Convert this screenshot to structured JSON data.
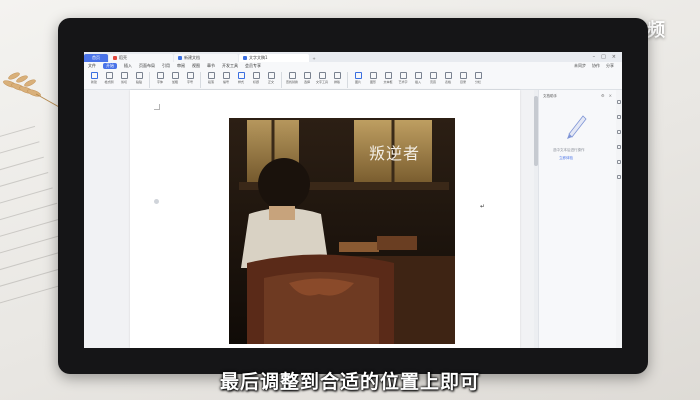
{
  "watermark": {
    "text": "天奇·视频"
  },
  "subtitle": {
    "text": "最后调整到合适的位置上即可"
  },
  "window": {
    "tabs": [
      {
        "label": "首页",
        "icon": "home-icon"
      },
      {
        "label": "稻壳",
        "icon": "docer-icon"
      },
      {
        "label": "新建文档",
        "icon": "doc-icon"
      },
      {
        "label": "文字文稿1",
        "icon": "doc-icon"
      }
    ],
    "menu": {
      "items": [
        "文件",
        "开始",
        "插入",
        "页面布局",
        "引用",
        "审阅",
        "视图",
        "章节",
        "开发工具",
        "会员专享"
      ],
      "right": [
        "未同步",
        "协作",
        "分享"
      ]
    },
    "toolbar": {
      "items": [
        "新建",
        "格式刷",
        "剪切",
        "粘贴",
        "字体",
        "加粗",
        "字号",
        "段落",
        "编号",
        "样式",
        "标题",
        "正文",
        "查找替换",
        "选择",
        "文字工具",
        "排版",
        "图片",
        "图形",
        "文本框",
        "艺术字",
        "插入",
        "页眉",
        "表格",
        "目录",
        "分栏"
      ]
    }
  },
  "document": {
    "image_caption": "叛逆者"
  },
  "side_panel": {
    "title": "文档助手",
    "hint": "选中文本后进行操作",
    "link": "立即体验"
  },
  "colors": {
    "accent": "#4a73e8",
    "monitor": "#151517"
  }
}
